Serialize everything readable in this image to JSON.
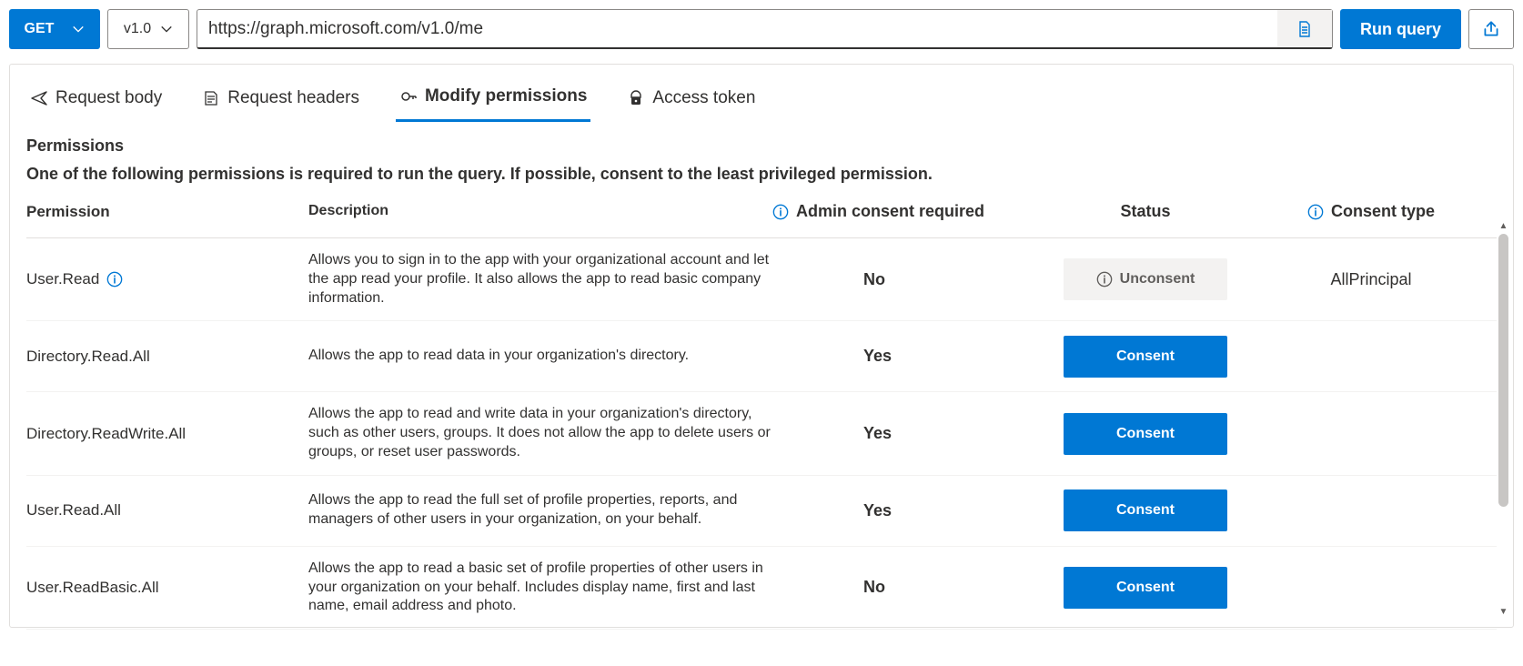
{
  "toolbar": {
    "method": "GET",
    "version": "v1.0",
    "url": "https://graph.microsoft.com/v1.0/me",
    "run_label": "Run query"
  },
  "tabs": [
    {
      "label": "Request body"
    },
    {
      "label": "Request headers"
    },
    {
      "label": "Modify permissions"
    },
    {
      "label": "Access token"
    }
  ],
  "section": {
    "heading": "Permissions",
    "desc": "One of the following permissions is required to run the query. If possible, consent to the least privileged permission."
  },
  "columns": {
    "permission": "Permission",
    "description": "Description",
    "admin": "Admin consent required",
    "status": "Status",
    "consent_type": "Consent type"
  },
  "rows": [
    {
      "permission": "User.Read",
      "info_icon": true,
      "description": "Allows you to sign in to the app with your organizational account and let the app read your profile. It also allows the app to read basic company information.",
      "admin": "No",
      "status_kind": "unconsent",
      "status_label": "Unconsent",
      "consent_type": "AllPrincipal"
    },
    {
      "permission": "Directory.Read.All",
      "info_icon": false,
      "description": "Allows the app to read data in your organization's directory.",
      "admin": "Yes",
      "status_kind": "consent",
      "status_label": "Consent",
      "consent_type": ""
    },
    {
      "permission": "Directory.ReadWrite.All",
      "info_icon": false,
      "description": "Allows the app to read and write data in your organization's directory, such as other users, groups. It does not allow the app to delete users or groups, or reset user passwords.",
      "admin": "Yes",
      "status_kind": "consent",
      "status_label": "Consent",
      "consent_type": ""
    },
    {
      "permission": "User.Read.All",
      "info_icon": false,
      "description": "Allows the app to read the full set of profile properties, reports, and managers of other users in your organization, on your behalf.",
      "admin": "Yes",
      "status_kind": "consent",
      "status_label": "Consent",
      "consent_type": ""
    },
    {
      "permission": "User.ReadBasic.All",
      "info_icon": false,
      "description": "Allows the app to read a basic set of profile properties of other users in your organization on your behalf. Includes display name, first and last name, email address and photo.",
      "admin": "No",
      "status_kind": "consent",
      "status_label": "Consent",
      "consent_type": ""
    }
  ]
}
